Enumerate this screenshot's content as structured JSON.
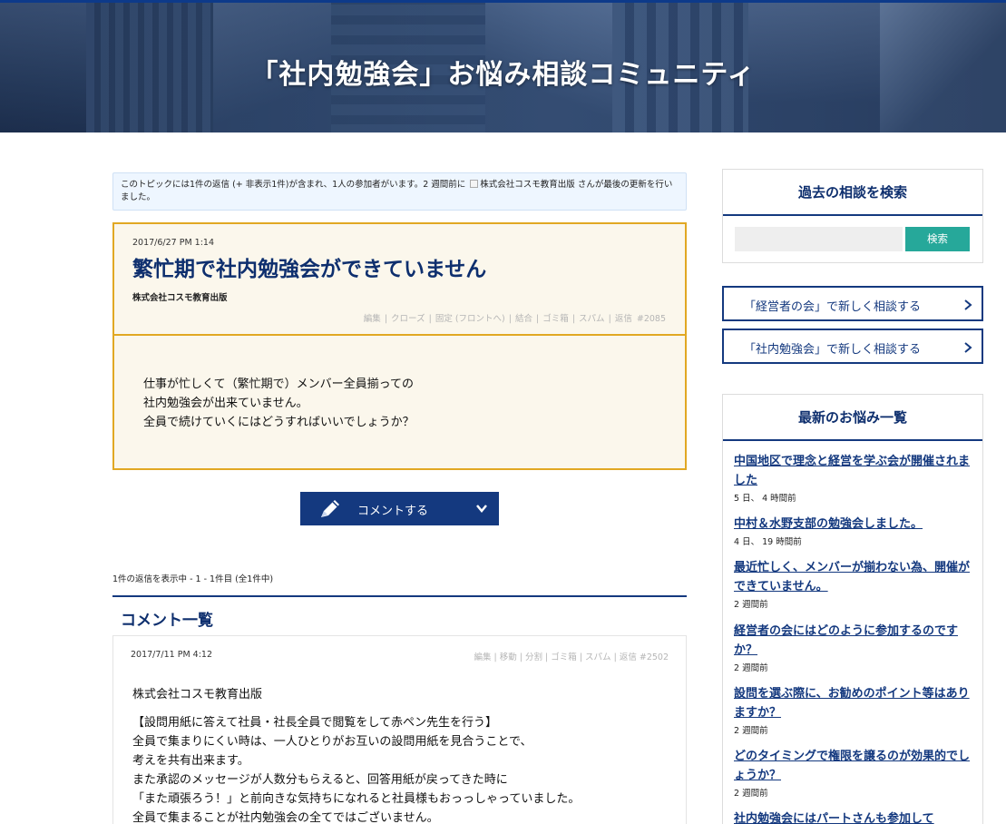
{
  "header": {
    "title": "「社内勉強会」お悩み相談コミュニティ"
  },
  "topic_info": {
    "text_before": "このトピックには1件の返信 (+ 非表示1件)が含まれ、1人の参加者がいます。2 週間前に",
    "user": "株式会社コスモ教育出版",
    "text_after": "さんが最後の更新を行いました。"
  },
  "topic": {
    "date": "2017/6/27 PM 1:14",
    "title": "繁忙期で社内勉強会ができていません",
    "author": "株式会社コスモ教育出版",
    "admin_links": [
      "編集",
      "クローズ",
      "固定 (フロントへ)",
      "結合",
      "ゴミ箱",
      "スパム",
      "返信"
    ],
    "post_id": "#2085",
    "body": [
      "仕事が忙しくて（繁忙期で）メンバー全員揃っての",
      "社内勉強会が出来ていません。",
      "全員で続けていくにはどうすればいいでしょうか？"
    ]
  },
  "comment_button": {
    "label": "コメントする"
  },
  "reply_count": "1件の返信を表示中 - 1 - 1件目 (全1件中)",
  "comments": {
    "title": "コメント一覧",
    "items": [
      {
        "date": "2017/7/11 PM 4:12",
        "admin_links": [
          "編集",
          "移動",
          "分割",
          "ゴミ箱",
          "スパム",
          "返信"
        ],
        "post_id": "#2502",
        "author": "株式会社コスモ教育出版",
        "lines": [
          "【設問用紙に答えて社員・社長全員で閲覧をして赤ペン先生を行う】",
          "全員で集まりにくい時は、一人ひとりがお互いの設問用紙を見合うことで、",
          "考えを共有出来ます。",
          "また承認のメッセージが人数分もらえると、回答用紙が戻ってきた時に",
          "「また頑張ろう！」と前向きな気持ちになれると社員様もおっっしゃっていました。",
          "全員で集まることが社内勉強会の全てではございません。"
        ]
      }
    ]
  },
  "sidebar": {
    "search": {
      "title": "過去の相談を検索",
      "placeholder": "",
      "button": "検索"
    },
    "links": [
      "「経営者の会」で新しく相談する",
      "「社内勉強会」で新しく相談する"
    ],
    "latest": {
      "title": "最新のお悩み一覧",
      "items": [
        {
          "title": "中国地区で理念と経営を学ぶ会が開催されました",
          "ago": "5 日、 4 時間前"
        },
        {
          "title": "中村＆水野支部の勉強会しました。",
          "ago": "4 日、 19 時間前"
        },
        {
          "title": "最近忙しく、メンバーが揃わない為、開催ができていません。",
          "ago": "2 週間前"
        },
        {
          "title": "経営者の会にはどのように参加するのですか？",
          "ago": "2 週間前"
        },
        {
          "title": "設問を選ぶ際に、お勧めのポイント等はありますか？",
          "ago": "2 週間前"
        },
        {
          "title": "どのタイミングで権限を譲るのが効果的でしょうか？",
          "ago": "2 週間前"
        },
        {
          "title": "社内勉強会にはパートさんも参加して",
          "ago": ""
        }
      ]
    }
  },
  "colors": {
    "navy": "#14397f",
    "title_navy": "#0e2f6e",
    "topic_border": "#e1a823",
    "topic_bg": "#fbf7ec",
    "search_button": "#26a89a",
    "info_bg": "#eef6ff"
  },
  "icons": {
    "topic_user": "user-icon",
    "comment_button": "pen-icon",
    "comment_button_toggle": "chevron-down-icon",
    "sidebar_link": "chevron-right-icon"
  }
}
